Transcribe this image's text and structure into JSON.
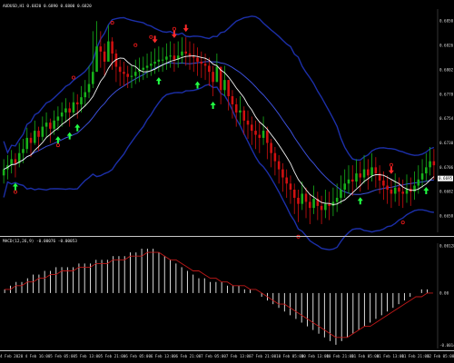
{
  "colors": {
    "background": "#000000",
    "separator": "#c8c8c8",
    "bull": "#17b21a",
    "bear": "#d11010",
    "bollinger": "#1c2fa8",
    "middle_band": "#3b4fd8",
    "ma": "#f2f2f2",
    "arrow_up": "#22ff44",
    "arrow_down": "#ff2a2a",
    "fractal": "#e01818",
    "macd_hist": "#f0f0f0",
    "macd_signal": "#c01818",
    "text": "#d8d8d8"
  },
  "chart_data": [
    {
      "type": "candlestick",
      "title": "AUDUSD,H1 0.6820 0.6890 0.6800 0.6820",
      "ylim": [
        0.6642,
        0.686
      ],
      "x_tick_labels": [
        "4 Feb 2020",
        "4 Feb 16:00",
        "5 Feb 05:00",
        "5 Feb 13:00",
        "5 Feb 21:00",
        "6 Feb 05:00",
        "6 Feb 13:00",
        "6 Feb 21:00",
        "7 Feb 05:00",
        "7 Feb 13:00",
        "7 Feb 21:00",
        "10 Feb 05:00",
        "10 Feb 13:00",
        "10 Feb 21:00",
        "11 Feb 05:00",
        "11 Feb 13:00",
        "11 Feb 21:00",
        "12 Feb 05:00"
      ],
      "y_tick_labels": [
        "0.6850",
        "0.6826",
        "0.6802",
        "0.6778",
        "0.6754",
        "0.6730",
        "0.6706",
        "0.6682",
        "0.6658"
      ],
      "y_tick_values": [
        0.685,
        0.6826,
        0.6802,
        0.6778,
        0.6754,
        0.673,
        0.6706,
        0.6682,
        0.6658
      ],
      "last_price_label": "0.6695",
      "last_price": 0.6695,
      "closes": [
        0.6704,
        0.6708,
        0.6714,
        0.671,
        0.672,
        0.6724,
        0.6735,
        0.673,
        0.6742,
        0.6736,
        0.6746,
        0.675,
        0.6744,
        0.6752,
        0.6756,
        0.676,
        0.6764,
        0.676,
        0.677,
        0.6768,
        0.6775,
        0.678,
        0.6788,
        0.68,
        0.6825,
        0.682,
        0.681,
        0.683,
        0.6818,
        0.6805,
        0.68,
        0.6798,
        0.6795,
        0.6796,
        0.68,
        0.6802,
        0.6804,
        0.6806,
        0.6808,
        0.681,
        0.6812,
        0.6812,
        0.6815,
        0.6816,
        0.6812,
        0.6816,
        0.682,
        0.6818,
        0.6815,
        0.6814,
        0.681,
        0.6808,
        0.6806,
        0.68,
        0.679,
        0.6805,
        0.6782,
        0.6792,
        0.6776,
        0.6768,
        0.676,
        0.6762,
        0.6752,
        0.6748,
        0.6742,
        0.6738,
        0.6735,
        0.6742,
        0.673,
        0.672,
        0.6712,
        0.6704,
        0.6696,
        0.669,
        0.6684,
        0.6676,
        0.667,
        0.668,
        0.6672,
        0.6666,
        0.6675,
        0.6668,
        0.6664,
        0.667,
        0.6668,
        0.6672,
        0.6676,
        0.6684,
        0.669,
        0.6694,
        0.6692,
        0.67,
        0.6696,
        0.6704,
        0.6698,
        0.6706,
        0.67,
        0.6693,
        0.6688,
        0.6684,
        0.668,
        0.6686,
        0.6682,
        0.668,
        0.6685,
        0.6682,
        0.6688,
        0.6694,
        0.67,
        0.6706,
        0.6712,
        0.6708
      ],
      "highs": [
        0.6714,
        0.6718,
        0.6723,
        0.672,
        0.673,
        0.6734,
        0.6745,
        0.674,
        0.6752,
        0.6746,
        0.6756,
        0.676,
        0.6754,
        0.6762,
        0.6766,
        0.677,
        0.6774,
        0.677,
        0.678,
        0.6778,
        0.6786,
        0.6792,
        0.6806,
        0.684,
        0.685,
        0.684,
        0.6828,
        0.6846,
        0.6834,
        0.6822,
        0.6812,
        0.681,
        0.6806,
        0.6807,
        0.6812,
        0.6814,
        0.6815,
        0.6818,
        0.682,
        0.6823,
        0.6825,
        0.6824,
        0.6828,
        0.683,
        0.6828,
        0.683,
        0.6834,
        0.6834,
        0.683,
        0.6828,
        0.6824,
        0.682,
        0.6818,
        0.6814,
        0.6806,
        0.6818,
        0.68,
        0.6806,
        0.6792,
        0.6782,
        0.6774,
        0.6776,
        0.6766,
        0.6762,
        0.6756,
        0.6752,
        0.675,
        0.6756,
        0.6746,
        0.6734,
        0.6726,
        0.6718,
        0.671,
        0.6704,
        0.6698,
        0.669,
        0.6684,
        0.6692,
        0.6686,
        0.668,
        0.6688,
        0.6682,
        0.6678,
        0.6684,
        0.6682,
        0.6686,
        0.669,
        0.6698,
        0.6704,
        0.6708,
        0.6708,
        0.6714,
        0.6712,
        0.6718,
        0.6714,
        0.672,
        0.6716,
        0.6708,
        0.6702,
        0.6698,
        0.6694,
        0.67,
        0.6696,
        0.6694,
        0.6699,
        0.6696,
        0.6702,
        0.6708,
        0.6714,
        0.672,
        0.6726,
        0.6724
      ],
      "lows": [
        0.669,
        0.6694,
        0.67,
        0.6696,
        0.6706,
        0.671,
        0.672,
        0.6716,
        0.6728,
        0.6722,
        0.6732,
        0.6736,
        0.673,
        0.6738,
        0.6742,
        0.6746,
        0.675,
        0.6746,
        0.6756,
        0.6754,
        0.676,
        0.6766,
        0.6774,
        0.6784,
        0.6806,
        0.6804,
        0.6796,
        0.6812,
        0.6802,
        0.679,
        0.6786,
        0.6786,
        0.6784,
        0.6784,
        0.6788,
        0.679,
        0.6792,
        0.6794,
        0.6796,
        0.6798,
        0.68,
        0.68,
        0.6802,
        0.6804,
        0.68,
        0.6804,
        0.6808,
        0.6806,
        0.6802,
        0.68,
        0.6796,
        0.6794,
        0.6792,
        0.6786,
        0.6776,
        0.679,
        0.6768,
        0.6776,
        0.6762,
        0.6754,
        0.6746,
        0.6748,
        0.6738,
        0.6734,
        0.6728,
        0.6724,
        0.672,
        0.6728,
        0.6714,
        0.6706,
        0.6698,
        0.669,
        0.6682,
        0.6676,
        0.667,
        0.666,
        0.6652,
        0.6664,
        0.6656,
        0.665,
        0.666,
        0.6654,
        0.665,
        0.6656,
        0.6654,
        0.6658,
        0.6662,
        0.667,
        0.6676,
        0.668,
        0.6678,
        0.6686,
        0.6682,
        0.669,
        0.6684,
        0.6692,
        0.6686,
        0.668,
        0.6674,
        0.667,
        0.6666,
        0.6672,
        0.6668,
        0.6666,
        0.6671,
        0.6668,
        0.6674,
        0.668,
        0.6686,
        0.6692,
        0.6698,
        0.6694
      ],
      "up_arrow_bars": [
        3,
        14,
        17,
        19,
        40,
        50,
        54,
        92,
        109
      ],
      "down_arrow_bars": [
        39,
        44,
        47,
        100
      ],
      "fractal_up_bars": [
        18,
        28,
        34,
        38,
        44,
        100
      ],
      "fractal_down_bars": [
        3,
        14,
        76,
        103
      ]
    },
    {
      "type": "bar",
      "title": "MACD(12,26,9) -0.00076 -0.00053",
      "ylim": [
        -0.0015,
        0.0013
      ],
      "y_tick_labels": [
        "0.00128",
        "0.00",
        "-0.00142"
      ],
      "y_tick_values": [
        0.00128,
        0.0,
        -0.00142
      ],
      "values": [
        0.0001,
        0.0002,
        0.0003,
        0.0003,
        0.0004,
        0.0005,
        0.0005,
        0.0006,
        0.0006,
        0.0007,
        0.0007,
        0.0007,
        0.0007,
        0.0008,
        0.0008,
        0.0008,
        0.0009,
        0.0009,
        0.0009,
        0.001,
        0.001,
        0.001,
        0.0011,
        0.0011,
        0.0012,
        0.0012,
        0.0012,
        0.0011,
        0.001,
        0.0009,
        0.0008,
        0.0007,
        0.0006,
        0.0005,
        0.0004,
        0.0004,
        0.0003,
        0.0003,
        0.0003,
        0.0002,
        0.0002,
        0.0002,
        0.0001,
        0.0001,
        0.0,
        -0.0001,
        -0.0002,
        -0.0003,
        -0.0004,
        -0.0005,
        -0.0006,
        -0.0007,
        -0.0008,
        -0.0009,
        -0.001,
        -0.0011,
        -0.0012,
        -0.0013,
        -0.0014,
        -0.0013,
        -0.0012,
        -0.0011,
        -0.001,
        -0.0009,
        -0.0008,
        -0.0007,
        -0.0006,
        -0.0005,
        -0.0004,
        -0.0003,
        -0.0002,
        -0.0001,
        0.0,
        0.0001,
        0.0001,
        0.0
      ],
      "signal": [
        0.0001,
        0.0001,
        0.0002,
        0.0002,
        0.0003,
        0.0003,
        0.0004,
        0.0004,
        0.0005,
        0.0005,
        0.0006,
        0.0006,
        0.0006,
        0.0007,
        0.0007,
        0.0007,
        0.0008,
        0.0008,
        0.0008,
        0.0009,
        0.0009,
        0.0009,
        0.001,
        0.001,
        0.001,
        0.0011,
        0.0011,
        0.0011,
        0.001,
        0.0009,
        0.0009,
        0.0008,
        0.0007,
        0.0006,
        0.0006,
        0.0005,
        0.0004,
        0.0004,
        0.0003,
        0.0003,
        0.0002,
        0.0002,
        0.0002,
        0.0001,
        0.0001,
        0.0,
        -0.0001,
        -0.0002,
        -0.0003,
        -0.0003,
        -0.0004,
        -0.0005,
        -0.0006,
        -0.0007,
        -0.0008,
        -0.0009,
        -0.001,
        -0.0011,
        -0.0012,
        -0.0012,
        -0.0012,
        -0.0011,
        -0.001,
        -0.0009,
        -0.0009,
        -0.0008,
        -0.0007,
        -0.0006,
        -0.0005,
        -0.0004,
        -0.0003,
        -0.0002,
        -0.0001,
        -0.0001,
        0.0,
        0.0
      ]
    }
  ]
}
